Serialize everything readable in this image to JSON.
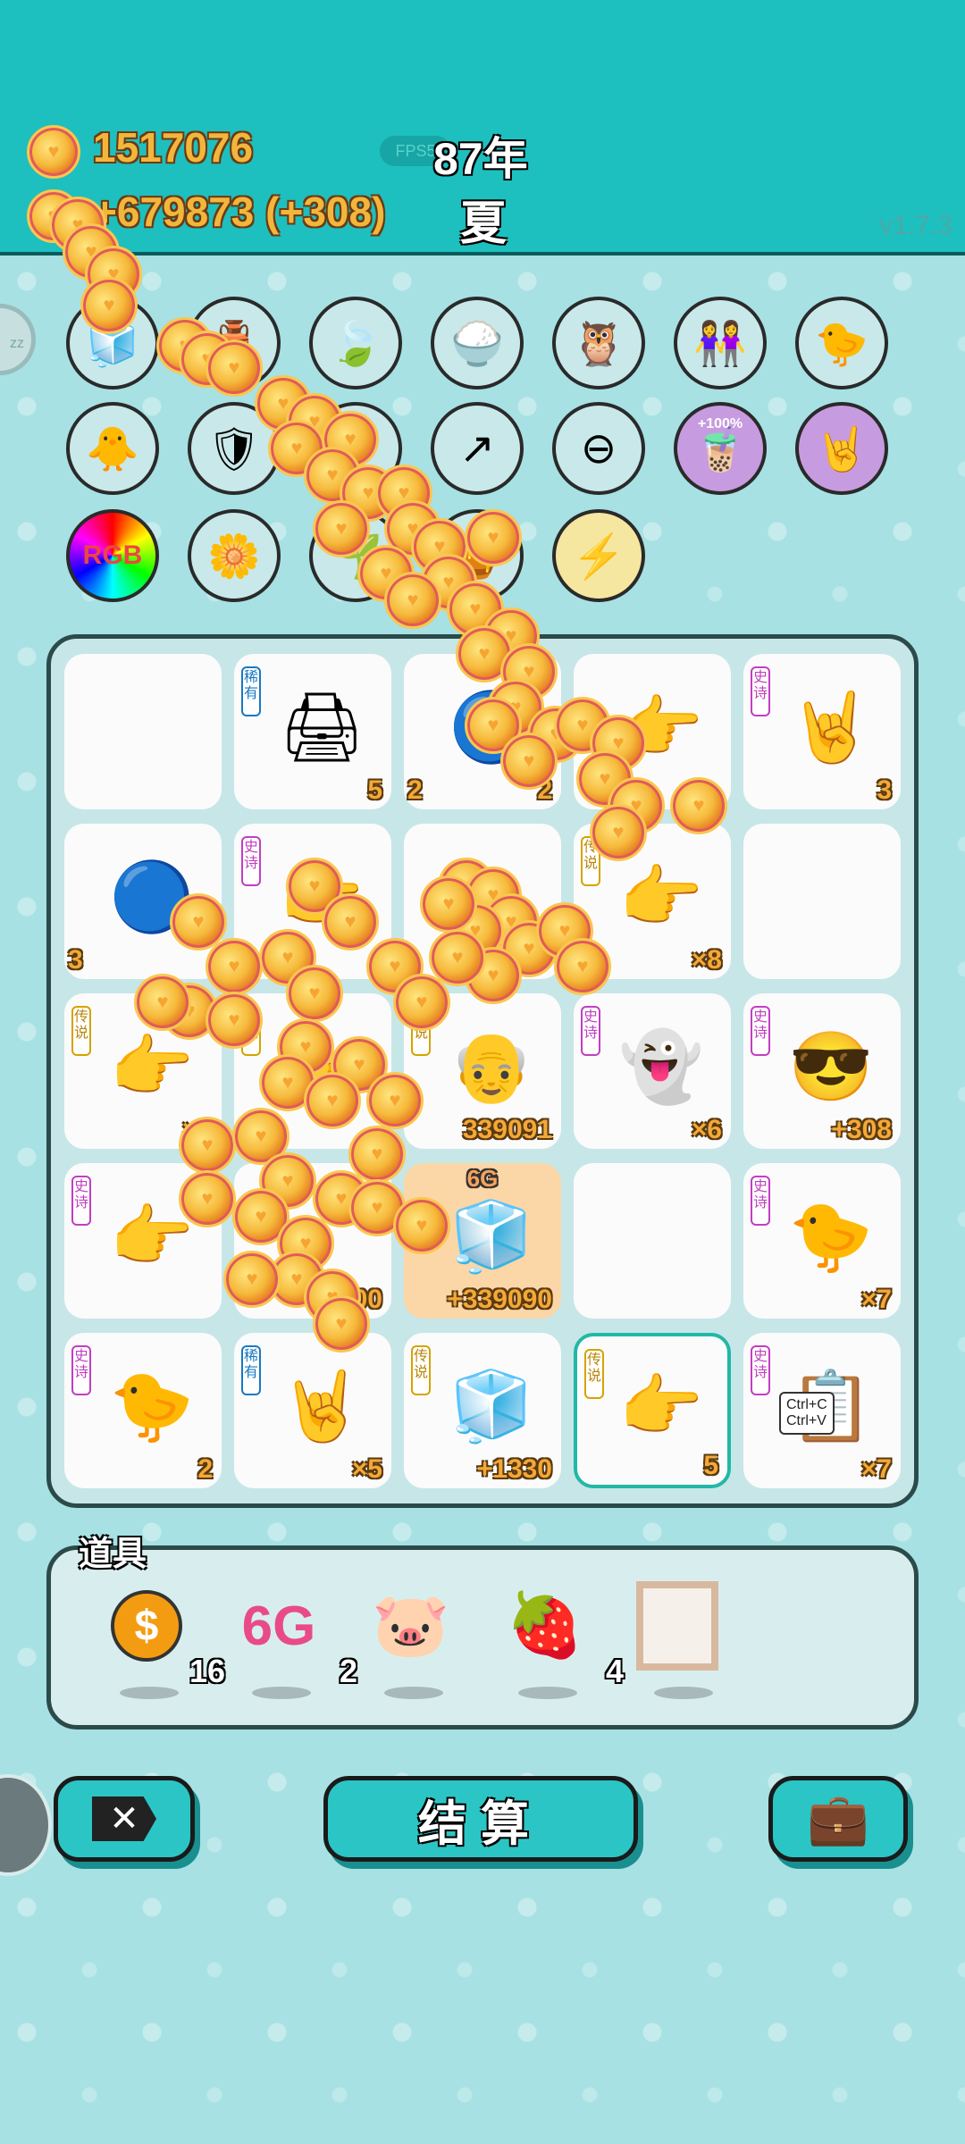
{
  "header": {
    "coins": "1517076",
    "income": "+679873 (+308)",
    "fps": "FPS5",
    "year": "87年",
    "season": "夏",
    "version": "v1.7.3",
    "sleep_label": "zz"
  },
  "perks": [
    {
      "name": "blocks",
      "icon": "🧊"
    },
    {
      "name": "pot",
      "icon": "🏺"
    },
    {
      "name": "leaf",
      "icon": "🍃"
    },
    {
      "name": "rice",
      "icon": "🍚"
    },
    {
      "name": "owl",
      "icon": "🦉"
    },
    {
      "name": "twins",
      "icon": "👭"
    },
    {
      "name": "chick-egg",
      "icon": "🐤"
    },
    {
      "name": "chick-egg-2",
      "icon": "🐥"
    },
    {
      "name": "shield",
      "icon": "🛡"
    },
    {
      "name": "unknown",
      "icon": "⚙"
    },
    {
      "name": "arrow-up",
      "icon": "↗"
    },
    {
      "name": "minus",
      "icon": "⊖"
    },
    {
      "name": "tea",
      "icon": "🧋",
      "label": "+100%"
    },
    {
      "name": "rock-hand",
      "icon": "🤘"
    },
    {
      "name": "rgb",
      "icon": "RGB"
    },
    {
      "name": "flower-pot",
      "icon": "🌼"
    },
    {
      "name": "plant",
      "icon": "🌱"
    },
    {
      "name": "pot-2",
      "icon": "🍯"
    },
    {
      "name": "lightning",
      "icon": "⚡"
    }
  ],
  "board": {
    "cells": [
      {
        "tag": "",
        "icon": "",
        "count": ""
      },
      {
        "tag": "稀有",
        "tag_type": "rare",
        "icon": "🖨",
        "count": "5"
      },
      {
        "tag": "",
        "icon": "🔵",
        "count": "2",
        "count2": "2"
      },
      {
        "tag": "",
        "icon": "👉",
        "count": ""
      },
      {
        "tag": "史诗",
        "tag_type": "epic",
        "icon": "🤘",
        "count": "3"
      },
      {
        "tag": "",
        "icon": "🔵",
        "count": "3",
        "left": true
      },
      {
        "tag": "史诗",
        "tag_type": "epic",
        "icon": "👉",
        "count": ""
      },
      {
        "tag": "",
        "icon": "",
        "count": ""
      },
      {
        "tag": "传说",
        "tag_type": "legend",
        "icon": "👉",
        "count": "×8"
      },
      {
        "tag": "",
        "icon": "",
        "count": ""
      },
      {
        "tag": "传说",
        "tag_type": "legend",
        "icon": "👉",
        "count": "×5"
      },
      {
        "tag": "传说",
        "tag_type": "legend",
        "icon": "👉",
        "count": ""
      },
      {
        "tag": "传说",
        "tag_type": "legend",
        "icon": "👴",
        "count": "339091"
      },
      {
        "tag": "史诗",
        "tag_type": "epic",
        "icon": "👻",
        "count": "×6"
      },
      {
        "tag": "史诗",
        "tag_type": "epic",
        "icon": "😎",
        "count": "+308"
      },
      {
        "tag": "史诗",
        "tag_type": "epic",
        "icon": "👉",
        "count": ""
      },
      {
        "tag": "",
        "icon": "",
        "count": "100"
      },
      {
        "tag": "",
        "icon": "🧊",
        "count": "+339090",
        "top": "6G",
        "orange": true
      },
      {
        "tag": "",
        "icon": "",
        "count": ""
      },
      {
        "tag": "史诗",
        "tag_type": "epic",
        "icon": "🐤",
        "count": "×7"
      },
      {
        "tag": "史诗",
        "tag_type": "epic",
        "icon": "🐤",
        "count": "2"
      },
      {
        "tag": "稀有",
        "tag_type": "rare",
        "icon": "🤘",
        "count": "×5"
      },
      {
        "tag": "传说",
        "tag_type": "legend",
        "icon": "🧊",
        "count": "+1330"
      },
      {
        "tag": "传说",
        "tag_type": "legend",
        "icon": "👉",
        "count": "5",
        "selected": true
      },
      {
        "tag": "史诗",
        "tag_type": "epic",
        "icon": "📋",
        "count": "×7",
        "text": "Ctrl+C\nCtrl+V"
      }
    ]
  },
  "items": {
    "title": "道具",
    "list": [
      {
        "name": "dollar-coin",
        "icon": "$",
        "count": "16"
      },
      {
        "name": "6g",
        "icon": "6G",
        "count": "2"
      },
      {
        "name": "piggy-bank",
        "icon": "🐷",
        "count": ""
      },
      {
        "name": "strawberry",
        "icon": "🍓",
        "count": "4"
      },
      {
        "name": "frame",
        "icon": "▢",
        "count": ""
      }
    ]
  },
  "buttons": {
    "close": "✕",
    "settle": "结算",
    "bag": "💼"
  }
}
